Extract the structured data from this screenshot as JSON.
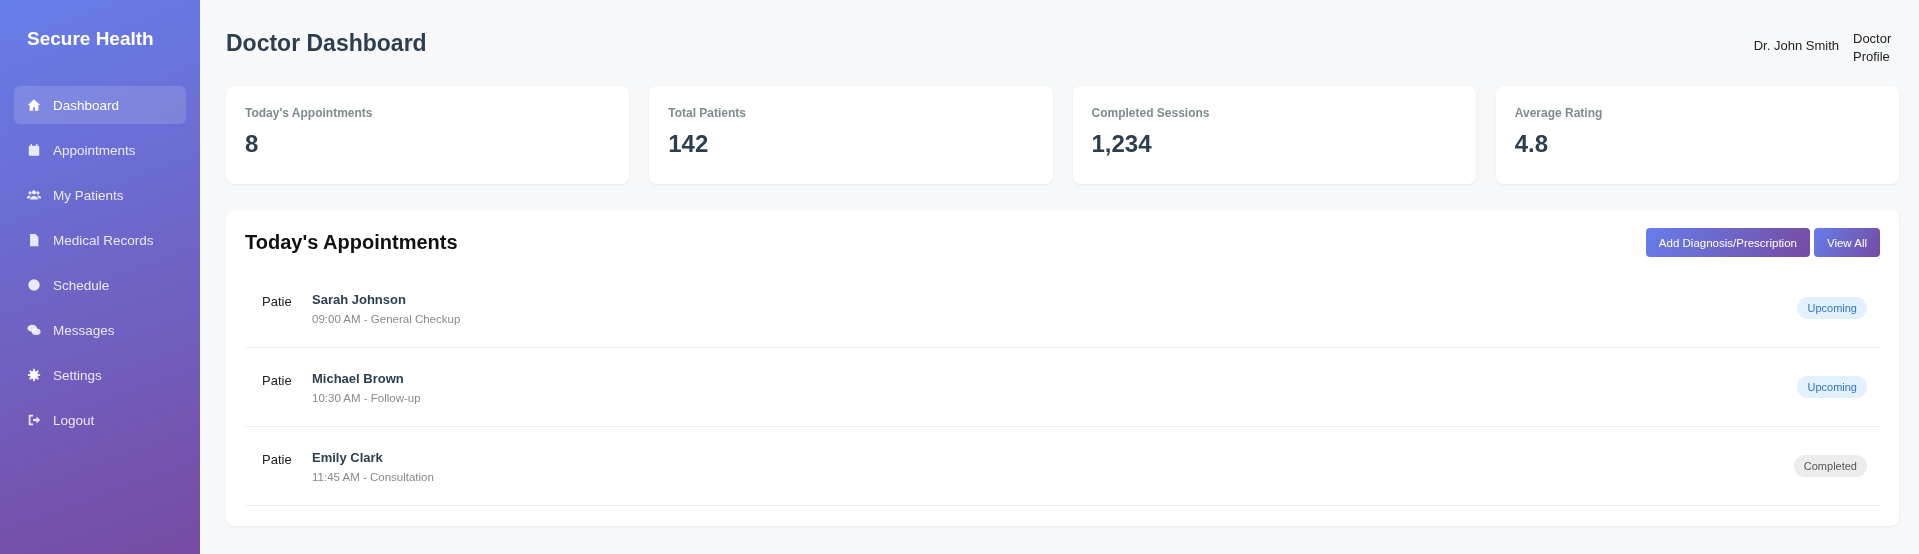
{
  "sidebar": {
    "brand": "Secure Health",
    "items": [
      {
        "label": "Dashboard",
        "selected": true
      },
      {
        "label": "Appointments",
        "selected": false
      },
      {
        "label": "My Patients",
        "selected": false
      },
      {
        "label": "Medical Records",
        "selected": false
      },
      {
        "label": "Schedule",
        "selected": false
      },
      {
        "label": "Messages",
        "selected": false
      },
      {
        "label": "Settings",
        "selected": false
      },
      {
        "label": "Logout",
        "selected": false
      }
    ]
  },
  "header": {
    "title": "Doctor Dashboard",
    "user_name": "Dr. John Smith",
    "profile_image_alt": "Doctor Profile"
  },
  "stats": [
    {
      "label": "Today's Appointments",
      "value": "8"
    },
    {
      "label": "Total Patients",
      "value": "142"
    },
    {
      "label": "Completed Sessions",
      "value": "1,234"
    },
    {
      "label": "Average Rating",
      "value": "4.8"
    }
  ],
  "appointments": {
    "title": "Today's Appointments",
    "buttons": [
      "Add Diagnosis/Prescription",
      "View All"
    ],
    "rows": [
      {
        "image_alt": "Patie",
        "name": "Sarah Johnson",
        "detail": "09:00 AM - General Checkup",
        "status": "Upcoming",
        "kind": "upcoming"
      },
      {
        "image_alt": "Patie",
        "name": "Michael Brown",
        "detail": "10:30 AM - Follow-up",
        "status": "Upcoming",
        "kind": "upcoming"
      },
      {
        "image_alt": "Patie",
        "name": "Emily Clark",
        "detail": "11:45 AM - Consultation",
        "status": "Completed",
        "kind": "completed"
      }
    ]
  }
}
